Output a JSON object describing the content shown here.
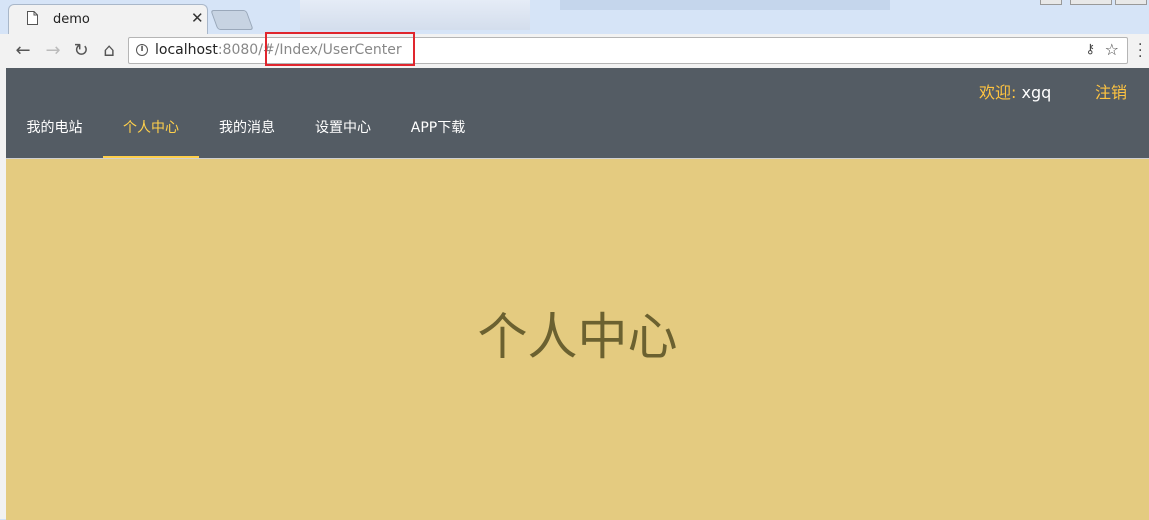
{
  "browser": {
    "tab_title": "demo",
    "url_host": "localhost",
    "url_rest": ":8080/#/Index/UserCenter"
  },
  "header": {
    "welcome_label": "欢迎: ",
    "username": "xgq",
    "logout_label": "注销"
  },
  "nav": {
    "items": [
      {
        "label": "我的电站"
      },
      {
        "label": "个人中心"
      },
      {
        "label": "我的消息"
      },
      {
        "label": "设置中心"
      },
      {
        "label": "APP下载"
      }
    ],
    "active_index": 1
  },
  "content": {
    "title": "个人中心"
  },
  "colors": {
    "header_bg": "#545c64",
    "active_nav": "#ffd04b",
    "content_bg": "#e4cb80",
    "highlight_box": "#e0262e"
  },
  "icons": [
    "page-icon",
    "close-icon",
    "back-arrow-icon",
    "forward-arrow-icon",
    "reload-icon",
    "home-icon",
    "info-icon",
    "key-icon",
    "star-icon",
    "menu-dots-icon"
  ]
}
